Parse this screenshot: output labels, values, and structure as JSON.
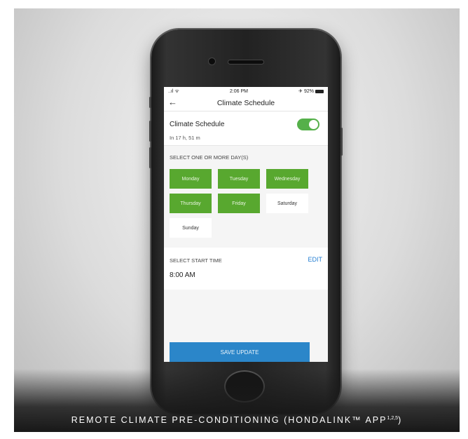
{
  "status_bar": {
    "time": "2:06 PM",
    "signal": "..ıl ᯤ",
    "battery": "✈ 92%"
  },
  "header": {
    "title": "Climate Schedule",
    "back_icon": "arrow-left-icon"
  },
  "schedule_toggle": {
    "label": "Climate Schedule",
    "subtitle": "In 17 h, 51 m",
    "enabled": true,
    "accent": "#55b04a"
  },
  "days": {
    "label": "SELECT ONE OR MORE DAY(S)",
    "items": [
      {
        "label": "Monday",
        "selected": true
      },
      {
        "label": "Tuesday",
        "selected": true
      },
      {
        "label": "Wednesday",
        "selected": true
      },
      {
        "label": "Thursday",
        "selected": true
      },
      {
        "label": "Friday",
        "selected": true
      },
      {
        "label": "Saturday",
        "selected": false
      },
      {
        "label": "Sunday",
        "selected": false
      }
    ],
    "selected_color": "#58a82f"
  },
  "start_time": {
    "label": "SELECT START TIME",
    "edit_label": "EDIT",
    "value": "8:00 AM"
  },
  "save_button": {
    "label": "SAVE UPDATE",
    "color": "#2b86c9"
  },
  "caption": {
    "text": "REMOTE CLIMATE PRE-CONDITIONING (HONDALINK™ APP",
    "superscript": "1,2,5",
    "suffix": ")"
  }
}
